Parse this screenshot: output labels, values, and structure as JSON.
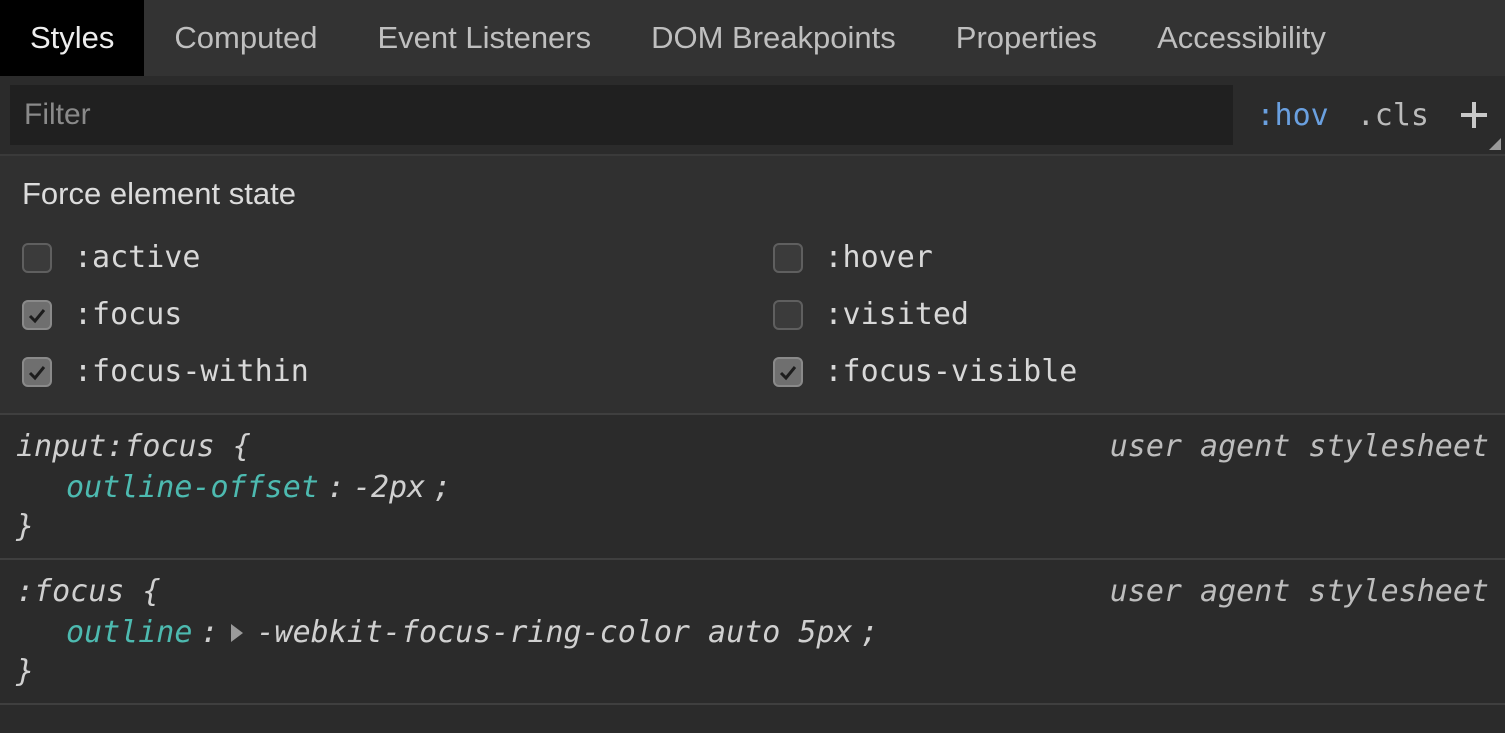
{
  "tabs": [
    "Styles",
    "Computed",
    "Event Listeners",
    "DOM Breakpoints",
    "Properties",
    "Accessibility"
  ],
  "activeTab": 0,
  "toolbar": {
    "filterPlaceholder": "Filter",
    "hov": ":hov",
    "cls": ".cls"
  },
  "forcePanel": {
    "title": "Force element state",
    "states": [
      {
        "label": ":active",
        "checked": false
      },
      {
        "label": ":hover",
        "checked": false
      },
      {
        "label": ":focus",
        "checked": true
      },
      {
        "label": ":visited",
        "checked": false
      },
      {
        "label": ":focus-within",
        "checked": true
      },
      {
        "label": ":focus-visible",
        "checked": true
      }
    ]
  },
  "rules": [
    {
      "selector": "input:focus",
      "source": "user agent stylesheet",
      "expandable": false,
      "property": "outline-offset",
      "value": "-2px"
    },
    {
      "selector": ":focus",
      "source": "user agent stylesheet",
      "expandable": true,
      "property": "outline",
      "value": "-webkit-focus-ring-color auto 5px"
    }
  ]
}
